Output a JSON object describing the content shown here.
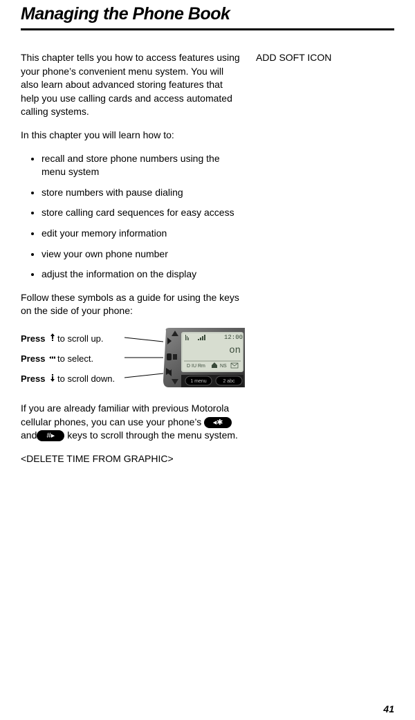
{
  "title": "Managing the Phone Book",
  "sideNote": "ADD SOFT ICON",
  "intro1": "This chapter tells you how to access features using your phone’s convenient menu system. You will also learn about advanced storing features that help you use calling cards and access automated calling systems.",
  "intro2": "In this chapter you will learn how to:",
  "bullets": [
    "recall and store phone numbers using the menu system",
    "store numbers with pause dialing",
    "store calling card sequences for easy access",
    "edit your memory information",
    "view your own phone number",
    "adjust the information on the display"
  ],
  "followSymbols": "Follow these symbols as a guide for using the keys on the side of your phone:",
  "diagram": {
    "pressWord": "Press",
    "rows": [
      {
        "icon": "up",
        "text": " to scroll up."
      },
      {
        "icon": "dot",
        "text": " to select."
      },
      {
        "icon": "down",
        "text": " to scroll down."
      }
    ],
    "phoneTime": "12:00",
    "phoneText": "on",
    "statusLine": "D IU Rm",
    "nsLabel": "NS",
    "key1": "1 menu",
    "key2": "2 abc"
  },
  "afterDiagram1a": "If you are already familiar with previous Motorola cellular phones, you can use your phone’s ",
  "keyStar": "◂✱",
  "andWord": "and",
  "keyHash": "#▸",
  "afterDiagram1b": " keys to scroll through the menu system.",
  "deleteNote": "<DELETE TIME FROM GRAPHIC>",
  "pageNumber": "41"
}
